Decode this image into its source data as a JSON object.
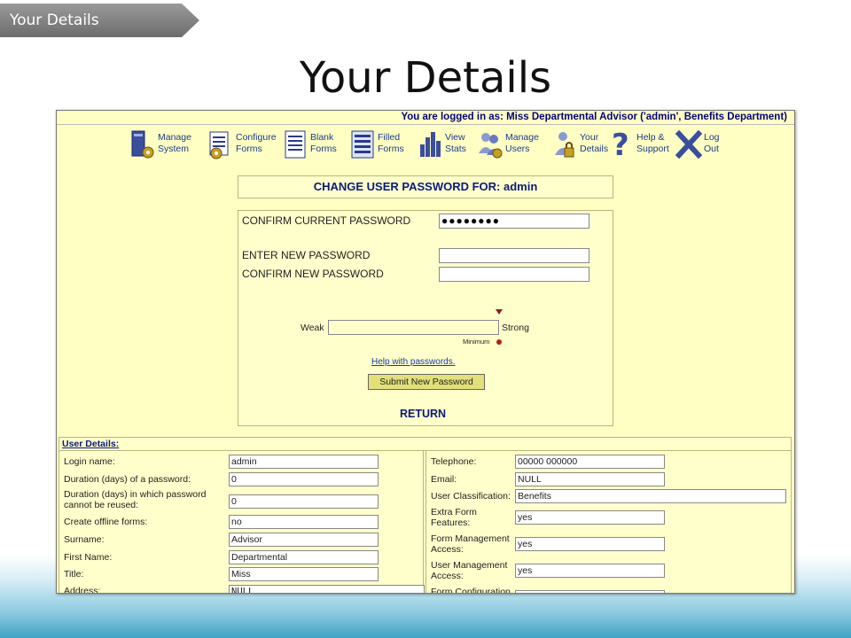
{
  "slide": {
    "tab_label": "Your Details",
    "title": "Your Details"
  },
  "app": {
    "logged_in_text": "You are logged in as: Miss Departmental Advisor ('admin', Benefits Department)",
    "nav": [
      {
        "line1": "Manage",
        "line2": "System",
        "icon": "manage-system-icon"
      },
      {
        "line1": "Configure",
        "line2": "Forms",
        "icon": "configure-forms-icon"
      },
      {
        "line1": "Blank",
        "line2": "Forms",
        "icon": "blank-forms-icon"
      },
      {
        "line1": "Filled",
        "line2": "Forms",
        "icon": "filled-forms-icon"
      },
      {
        "line1": "View",
        "line2": "Stats",
        "icon": "view-stats-icon"
      },
      {
        "line1": "Manage",
        "line2": "Users",
        "icon": "manage-users-icon"
      },
      {
        "line1": "Your",
        "line2": "Details",
        "icon": "your-details-icon"
      },
      {
        "line1": "Help &",
        "line2": "Support",
        "icon": "help-icon"
      },
      {
        "line1": "Log",
        "line2": "Out",
        "icon": "logout-icon"
      }
    ],
    "password": {
      "heading": "CHANGE USER PASSWORD FOR: admin",
      "current_label": "CONFIRM CURRENT PASSWORD",
      "current_value": "●●●●●●●●",
      "new_label": "ENTER NEW PASSWORD",
      "new_value": "",
      "confirm_label": "CONFIRM NEW PASSWORD",
      "confirm_value": "",
      "weak_label": "Weak",
      "strong_label": "Strong",
      "minimum_label": "Minimum",
      "help_link": "Help with passwords.",
      "submit_label": "Submit New Password",
      "return_label": "RETURN"
    },
    "user_details": {
      "heading": "User Details:",
      "left": [
        {
          "label": "Login name:",
          "value": "admin"
        },
        {
          "label": "Duration (days) of a password:",
          "value": "0"
        },
        {
          "label": "Duration (days) in which password cannot be reused:",
          "value": "0"
        },
        {
          "label": "Create offline forms:",
          "value": "no"
        },
        {
          "label": "Surname:",
          "value": "Advisor"
        },
        {
          "label": "First Name:",
          "value": "Departmental"
        },
        {
          "label": "Title:",
          "value": "Miss"
        },
        {
          "label": "Address:",
          "value": "NULL"
        }
      ],
      "right": [
        {
          "label": "Telephone:",
          "value": "00000 000000"
        },
        {
          "label": "Email:",
          "value": "NULL"
        },
        {
          "label": "User Classification:",
          "value": "Benefits"
        },
        {
          "label": "Extra Form Features:",
          "value": "yes"
        },
        {
          "label": "Form Management Access:",
          "value": "yes"
        },
        {
          "label": "User Management Access:",
          "value": "yes"
        },
        {
          "label": "Form Configuration",
          "value": ""
        }
      ]
    }
  }
}
